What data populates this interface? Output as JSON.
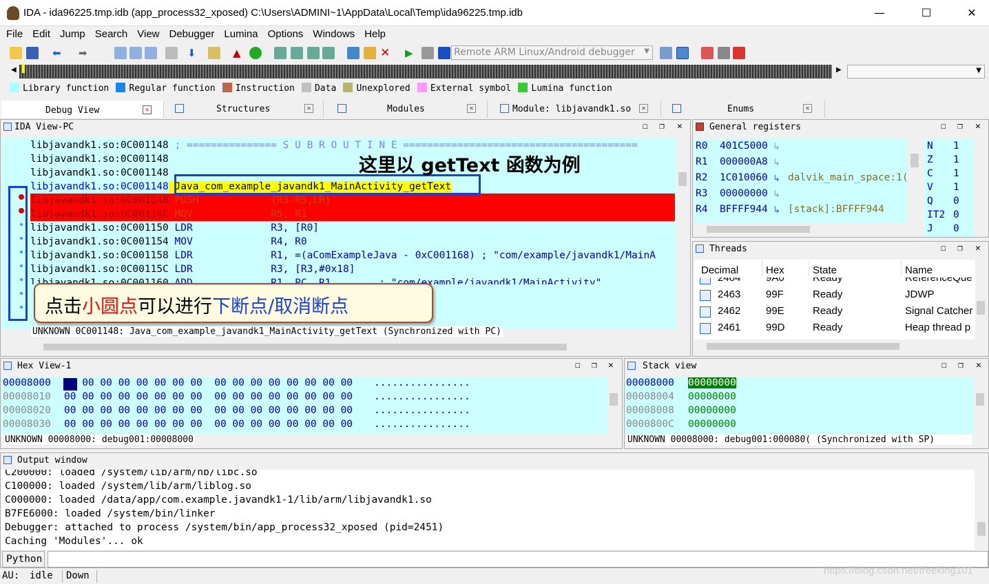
{
  "window": {
    "title": "IDA - ida96225.tmp.idb (app_process32_xposed) C:\\Users\\ADMINI~1\\AppData\\Local\\Temp\\ida96225.tmp.idb",
    "minimize": "—",
    "maximize": "☐",
    "close": "✕"
  },
  "menu": [
    "File",
    "Edit",
    "Jump",
    "Search",
    "View",
    "Debugger",
    "Lumina",
    "Options",
    "Windows",
    "Help"
  ],
  "toolbar": {
    "debugger_select": "Remote ARM Linux/Android debugger"
  },
  "legend": [
    {
      "label": "Library function",
      "color": "#aaffff"
    },
    {
      "label": "Regular function",
      "color": "#1188ee"
    },
    {
      "label": "Instruction",
      "color": "#b96a45"
    },
    {
      "label": "Data",
      "color": "#c0c0c0"
    },
    {
      "label": "Unexplored",
      "color": "#b4b46e"
    },
    {
      "label": "External symbol",
      "color": "#ff99ff"
    },
    {
      "label": "Lumina function",
      "color": "#33cc33"
    }
  ],
  "tabs": [
    {
      "label": "Debug View"
    },
    {
      "label": "Structures"
    },
    {
      "label": "Modules"
    },
    {
      "label": "Module: libjavandk1.so"
    },
    {
      "label": "Enums"
    }
  ],
  "ida_view": {
    "title": "IDA View-PC",
    "lines": [
      {
        "addr": "libjavandk1.so:0C001148",
        "text": " ; =============== S U B R O U T I N E ======================================="
      },
      {
        "addr": "libjavandk1.so:0C001148",
        "text": ""
      },
      {
        "addr": "libjavandk1.so:0C001148",
        "text": ""
      },
      {
        "addr": "libjavandk1.so:0C001148",
        "text": " Java_com_example_javandk1_MainActivity_getText"
      },
      {
        "addr": "libjavandk1.so:0C001148",
        "text": " PUSH            {R3-R5,LR}"
      },
      {
        "addr": "libjavandk1.so:0C00114C",
        "text": " MOV             R5, R1"
      },
      {
        "addr": "libjavandk1.so:0C001150",
        "text": " LDR             R3, [R0]"
      },
      {
        "addr": "libjavandk1.so:0C001154",
        "text": " MOV             R4, R0"
      },
      {
        "addr": "libjavandk1.so:0C001158",
        "text": " LDR             R1, =(aComExampleJava - 0xC001168) ; \"com/example/javandk1/MainA"
      },
      {
        "addr": "libjavandk1.so:0C00115C",
        "text": " LDR             R3, [R3,#0x18]"
      },
      {
        "addr": "libjavandk1.so:0C001160",
        "text": " ADD             R1, PC, R1        ; \"com/example/javandk1/MainActivity\""
      }
    ],
    "status": "UNKNOWN 0C001148: Java_com_example_javandk1_MainActivity_getText (Synchronized with PC)",
    "annotation_top": "这里以 getText 函数为例",
    "annotation_bottom_a": "点击",
    "annotation_bottom_b": "小圆点",
    "annotation_bottom_c": "可以进行",
    "annotation_bottom_d": "下断点/取消断点"
  },
  "registers": {
    "title": "General registers",
    "rows": [
      {
        "name": "R0",
        "value": "401C5000",
        "note": ""
      },
      {
        "name": "R1",
        "value": "000000A8",
        "note": ""
      },
      {
        "name": "R2",
        "value": "1C010060",
        "note": "dalvik_main_space:1("
      },
      {
        "name": "R3",
        "value": "00000000",
        "note": ""
      },
      {
        "name": "R4",
        "value": "BFFFF944",
        "note": "[stack]:BFFFF944"
      }
    ],
    "flags": [
      {
        "name": "N",
        "value": "1"
      },
      {
        "name": "Z",
        "value": "1"
      },
      {
        "name": "C",
        "value": "1"
      },
      {
        "name": "V",
        "value": "1"
      },
      {
        "name": "Q",
        "value": "0"
      },
      {
        "name": "IT2",
        "value": "0"
      },
      {
        "name": "J",
        "value": "0"
      }
    ]
  },
  "threads": {
    "title": "Threads",
    "headers": [
      "Decimal",
      "Hex",
      "State",
      "Name"
    ],
    "rows": [
      [
        "2464",
        "9A0",
        "Ready",
        "ReferenceQue"
      ],
      [
        "2463",
        "99F",
        "Ready",
        "JDWP"
      ],
      [
        "2462",
        "99E",
        "Ready",
        "Signal Catcher"
      ],
      [
        "2461",
        "99D",
        "Ready",
        "Heap thread p"
      ]
    ]
  },
  "hex_view": {
    "title": "Hex View-1",
    "rows": [
      {
        "addr": "00008000",
        "bytes": "00 00 00 00 00 00 00 00  00 00 00 00 00 00 00 00",
        "ascii": "................"
      },
      {
        "addr": "00008010",
        "bytes": "00 00 00 00 00 00 00 00  00 00 00 00 00 00 00 00",
        "ascii": "................"
      },
      {
        "addr": "00008020",
        "bytes": "00 00 00 00 00 00 00 00  00 00 00 00 00 00 00 00",
        "ascii": "................"
      },
      {
        "addr": "00008030",
        "bytes": "00 00 00 00 00 00 00 00  00 00 00 00 00 00 00 00",
        "ascii": "................"
      }
    ],
    "status": "UNKNOWN 00008000: debug001:00008000"
  },
  "stack_view": {
    "title": "Stack view",
    "rows": [
      {
        "addr": "00008000",
        "value": "00000000"
      },
      {
        "addr": "00008004",
        "value": "00000000"
      },
      {
        "addr": "00008008",
        "value": "00000000"
      },
      {
        "addr": "0000800C",
        "value": "00000000"
      }
    ],
    "status": "UNKNOWN 00008000: debug001:000080( (Synchronized with SP)"
  },
  "output": {
    "title": "Output window",
    "lines": [
      "C200000: loaded /system/lib/arm/nb/libc.so",
      "C100000: loaded /system/lib/arm/liblog.so",
      "C000000: loaded /data/app/com.example.javandk1-1/lib/arm/libjavandk1.so",
      "B7FE6000: loaded /system/bin/linker",
      "Debugger: attached to process /system/bin/app_process32_xposed (pid=2451)",
      "Caching 'Modules'... ok"
    ],
    "python_button": "Python",
    "command_value": ""
  },
  "statusbar": {
    "au": "AU:",
    "state": "idle",
    "direction": "Down",
    "watermark": "https://blog.csdn.net/freeking101"
  }
}
